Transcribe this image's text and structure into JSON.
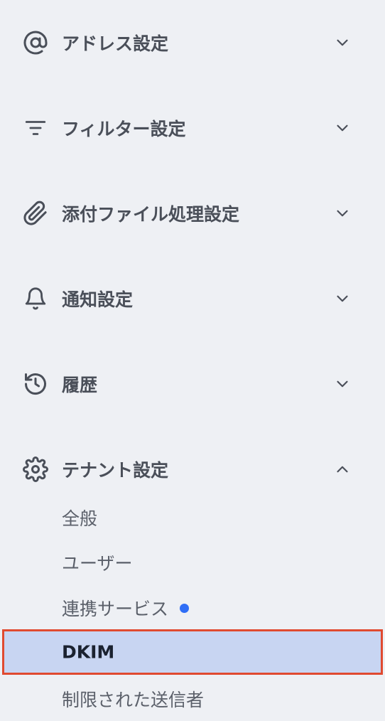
{
  "sections": [
    {
      "label": "アドレス設定",
      "icon": "at-sign-icon",
      "expanded": false
    },
    {
      "label": "フィルター設定",
      "icon": "filter-icon",
      "expanded": false
    },
    {
      "label": "添付ファイル処理設定",
      "icon": "paperclip-icon",
      "expanded": false
    },
    {
      "label": "通知設定",
      "icon": "bell-icon",
      "expanded": false
    },
    {
      "label": "履歴",
      "icon": "history-icon",
      "expanded": false
    },
    {
      "label": "テナント設定",
      "icon": "gear-icon",
      "expanded": true
    }
  ],
  "tenant_items": [
    {
      "label": "全般"
    },
    {
      "label": "ユーザー"
    },
    {
      "label": "連携サービス",
      "badge": "new-dot"
    },
    {
      "label": "DKIM",
      "active": true
    },
    {
      "label": "制限された送信者"
    }
  ],
  "colors": {
    "background": "#eef0f4",
    "text": "#4a4f59",
    "active_bg": "#c8d5f2",
    "active_border": "#e04a30",
    "badge_dot": "#2f6ef6"
  }
}
